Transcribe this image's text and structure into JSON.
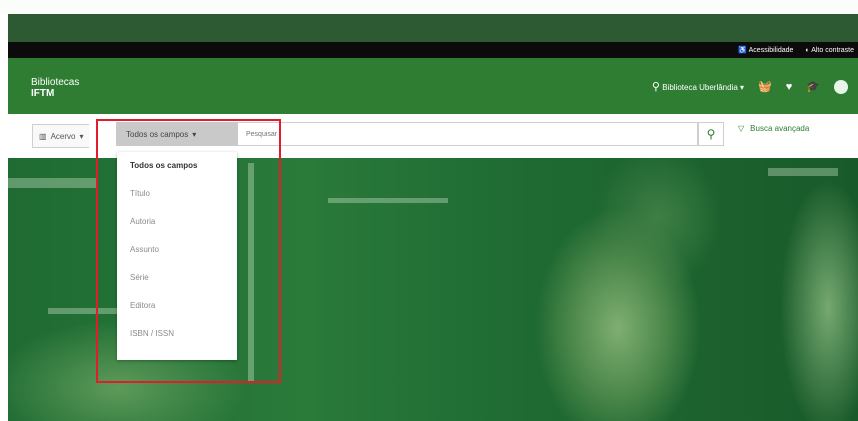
{
  "topbar": {
    "accessibility_label": "Acessibilidade",
    "contrast_label": "Alto contraste"
  },
  "header": {
    "brand_line1": "Bibliotecas",
    "brand_line2": "IFTM",
    "library_select": "Biblioteca Uberlândia"
  },
  "search": {
    "collection_label": "Acervo",
    "field_label": "Todos os campos",
    "placeholder": "Pesquisar",
    "advanced_label": "Busca avançada"
  },
  "dropdown": {
    "items": [
      "Todos os campos",
      "Título",
      "Autoria",
      "Assunto",
      "Série",
      "Editora",
      "ISBN / ISSN"
    ],
    "selected_index": 0
  },
  "colors": {
    "brand_green": "#2e7d32",
    "highlight_red": "#e11d2a"
  }
}
